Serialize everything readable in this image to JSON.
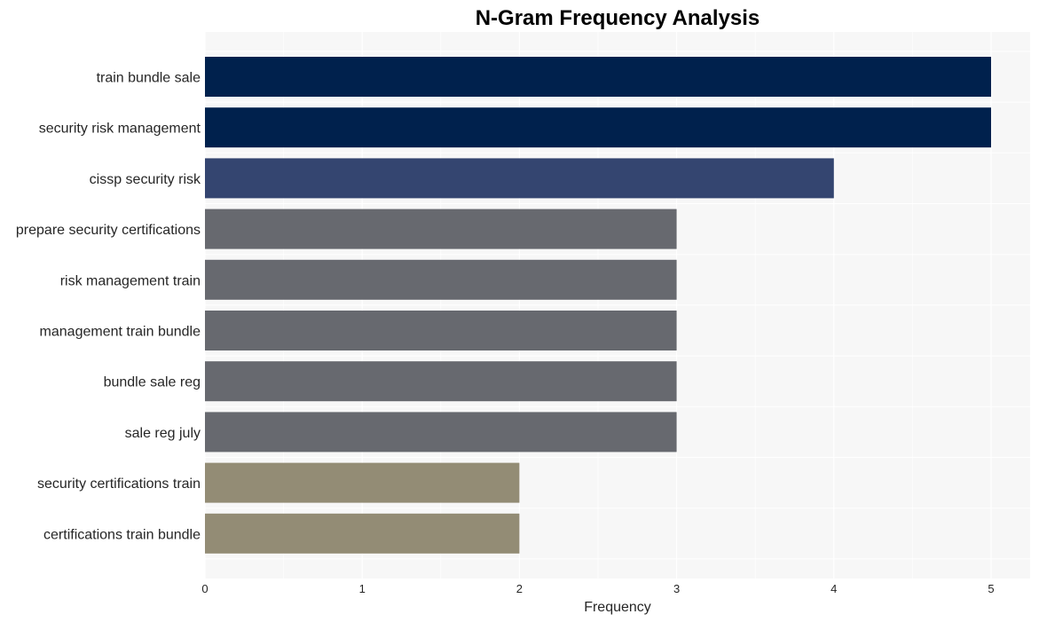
{
  "chart_data": {
    "type": "bar",
    "orientation": "horizontal",
    "title": "N-Gram Frequency Analysis",
    "xlabel": "Frequency",
    "ylabel": "",
    "xlim": [
      0,
      5.25
    ],
    "xticks": [
      0,
      1,
      2,
      3,
      4,
      5
    ],
    "grid": true,
    "categories": [
      "train bundle sale",
      "security risk management",
      "cissp security risk",
      "prepare security certifications",
      "risk management train",
      "management train bundle",
      "bundle sale reg",
      "sale reg july",
      "security certifications train",
      "certifications train bundle"
    ],
    "values": [
      5,
      5,
      4,
      3,
      3,
      3,
      3,
      3,
      2,
      2
    ],
    "colors": [
      "#00214d",
      "#00214d",
      "#344570",
      "#67696f",
      "#67696f",
      "#67696f",
      "#67696f",
      "#67696f",
      "#938c75",
      "#938c75"
    ],
    "background": "#f7f7f7"
  }
}
